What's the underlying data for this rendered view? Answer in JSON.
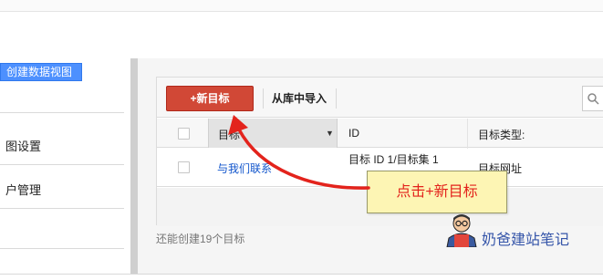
{
  "sidebar": {
    "create_view_label": "创建数据视图",
    "items": [
      {
        "label": "图设置"
      },
      {
        "label": "户管理"
      }
    ]
  },
  "toolbar": {
    "new_goal_label": "+新目标",
    "import_label": "从库中导入"
  },
  "table": {
    "headers": {
      "goal": "目标",
      "id": "ID",
      "type": "目标类型:"
    },
    "rows": [
      {
        "goal": "与我们联系",
        "id": "目标 ID 1/目标集 1",
        "type": "目标网址"
      }
    ]
  },
  "footer": {
    "remaining": "还能创建19个目标"
  },
  "callout": {
    "text": "点击+新目标"
  },
  "watermark": {
    "text": "奶爸建站笔记"
  },
  "colors": {
    "primary_button": "#d14836",
    "link": "#1155cc",
    "create_view": "#4d90fe",
    "callout_bg": "#fdf5b4",
    "callout_text": "#e3231c",
    "arrow": "#e3231c"
  },
  "icons": [
    "search-icon",
    "sort-desc-icon",
    "arrow-annotation-icon",
    "avatar-icon"
  ]
}
